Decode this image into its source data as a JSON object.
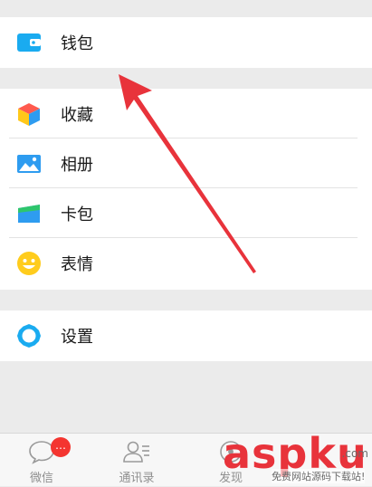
{
  "menu": {
    "wallet": "钱包",
    "favorites": "收藏",
    "album": "相册",
    "cards": "卡包",
    "stickers": "表情",
    "settings": "设置"
  },
  "tabs": [
    {
      "label": "微信",
      "icon": "chat-icon",
      "badge": "…"
    },
    {
      "label": "通讯录",
      "icon": "contacts-icon"
    },
    {
      "label": "发现",
      "icon": "discover-icon"
    }
  ],
  "watermark": {
    "brand": "aspku",
    "domain": ".com",
    "tagline": "免费网站源码下载站!"
  },
  "colors": {
    "wallet": "#1aabf0",
    "accent_red": "#f43530",
    "arrow": "#e8333b"
  }
}
